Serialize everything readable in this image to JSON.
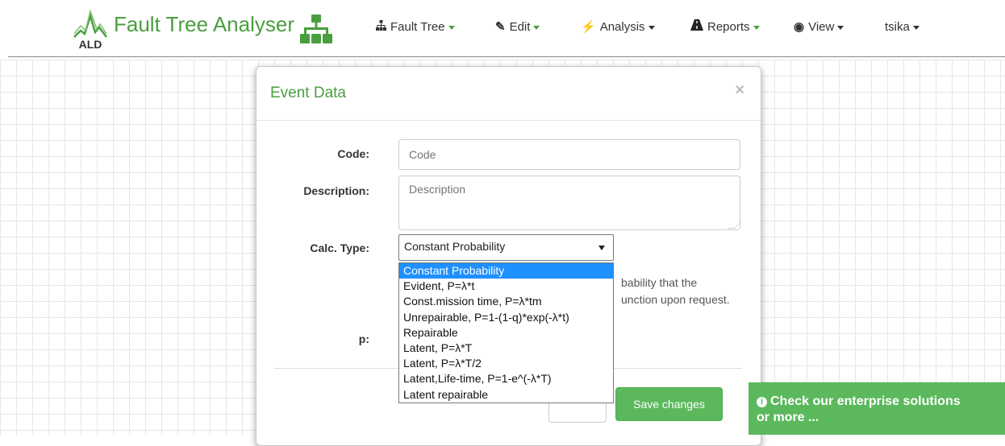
{
  "brand": {
    "logo_text": "ALD",
    "title": "Fault Tree Analyser"
  },
  "nav": [
    {
      "label": "Fault Tree",
      "icon": "sitemap-icon"
    },
    {
      "label": "Edit",
      "icon": "edit-icon"
    },
    {
      "label": "Analysis",
      "icon": "bolt-icon"
    },
    {
      "label": "Reports",
      "icon": "road-icon"
    },
    {
      "label": "View",
      "icon": "eye-icon"
    },
    {
      "label": "tsika"
    }
  ],
  "modal": {
    "title": "Event Data",
    "close": "×",
    "code_label": "Code:",
    "code_placeholder": "Code",
    "description_label": "Description:",
    "description_placeholder": "Description",
    "calc_label": "Calc. Type:",
    "calc_selected": "Constant Probability",
    "calc_options": [
      "Constant Probability",
      "Evident, P=λ*t",
      "Const.mission time, P=λ*tm",
      "Unrepairable, P=1-(1-q)*exp(-λ*t)",
      "Repairable",
      "Latent, P=λ*T",
      "Latent, P=λ*T/2",
      "Latent,Life-time, P=1-e^(-λ*T)",
      "Latent repairable"
    ],
    "help_line1": "bability that the",
    "help_line2": "unction upon request.",
    "p_label": "p:",
    "save_label": "Save changes"
  },
  "promo": {
    "line1": "Check our enterprise solutions",
    "line2": "or more ..."
  },
  "colors": {
    "brand_green": "#4a9e3f",
    "button_green": "#5cb85c",
    "selected_option": "#1e90ff"
  }
}
